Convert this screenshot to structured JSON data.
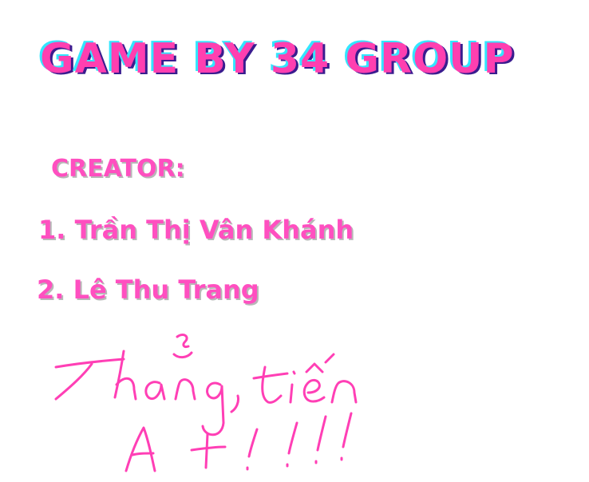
{
  "title": "GAME BY 34 GROUP",
  "creators_heading": "CREATOR:",
  "creators": [
    "1. Trần Thị Vân Khánh",
    "2. Lê Thu Trang"
  ],
  "handwritten_note": "Thắng tiến A+!!!",
  "colors": {
    "title_pink": "#ff3fb0",
    "title_cyan_shadow": "#33e6ff",
    "title_dark_shadow": "#3a1c8f",
    "text_pink": "#ff4fc0",
    "handwriting_pink": "#ff3fb5",
    "background": "#ffffff"
  }
}
